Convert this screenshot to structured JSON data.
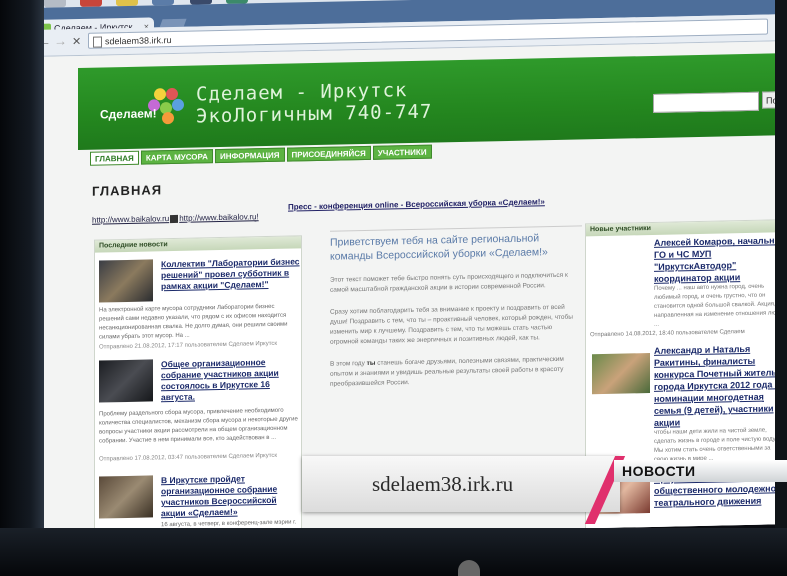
{
  "browser": {
    "tab_title": "Сделаем - Иркутск Эко...",
    "tab_close": "×",
    "url": "sdelaem38.irk.ru",
    "back": "←",
    "forward": "→",
    "stop": "✕"
  },
  "site": {
    "logo_text": "Сделаем!",
    "title_line1": "Сделаем - Иркутск",
    "title_line2": "ЭкоЛогичным 740-747",
    "search_button": "Пои",
    "menu": [
      "ГЛАВНАЯ",
      "КАРТА МУСОРА",
      "ИНФОРМАЦИЯ",
      "ПРИСОЕДИНЯЙСЯ",
      "УЧАСТНИКИ"
    ],
    "page_title": "ГЛАВНАЯ",
    "links_line": "http://www.baikalov.ru",
    "links_line2": "http://www.baikalov.ru",
    "links_line3": "!",
    "press_link": "Пресс - конференция online - Всероссийская уборка «Сделаем!»"
  },
  "left_column": {
    "heading": "Последние новости",
    "news": [
      {
        "title": "Коллектив \"Лаборатории бизнес решений\" провел субботник в рамках акции \"Сделаем!\"",
        "body": "На электронной карте мусора сотрудники Лаборатории бизнес решений сами недавно указали, что рядом с их офисом находится несанкционированная свалка. Не долго думая, они решили своими силами убрать этот мусор. На ...",
        "meta": "Отправлено 21.08.2012, 17:17 пользователем Сделаем Иркутск"
      },
      {
        "title": "Общее организационное собрание участников акции состоялось в Иркутске 16 августа.",
        "body": "Проблему раздельного сбора мусора, привлечение необходимого количества специалистов, механизм сбора мусора и некоторые другие вопросы участники акции рассмотрели на общем организационном собрании. Участие в нем принимали все, кто задействован в ...",
        "meta": "Отправлено 17.08.2012, 03:47 пользователем Сделаем Иркутск"
      },
      {
        "title": "В Иркутске пройдет организационное собрание участников Всероссийской акции «Сделаем!»",
        "body": "16 августа, в четверг, в конференц-зале мэрии г.",
        "meta": ""
      }
    ]
  },
  "center_column": {
    "title": "Приветствуем тебя на сайте региональной команды Всероссийской уборки «Сделаем!»",
    "p1": "Этот текст поможет тебе быстро понять суть происходящего и подключиться к самой масштабной гражданской акции в истории современной России.",
    "p2": "Сразу хотим поблагодарить тебя за внимание к проекту и поздравить от всей души! Поздравить с тем, что ты – проактивный человек, который рожден, чтобы изменить мир к лучшему. Поздравить с тем, что ты можешь стать частью огромной команды таких же энергичных и позитивных людей, как ты.",
    "p3_bold": "ты",
    "p3_a": "В этом году",
    "p3_b": "станешь богаче друзьями, полезными связями, практическим опытом и знаниями и увидишь реальные результаты своей работы в красоту преобразившейся России."
  },
  "right_column": {
    "heading": "Новые участники",
    "items": [
      {
        "title": "Алексей Комаров, начальник ГО и ЧС МУП \"ИркутскАвтодор\" координатор акции",
        "body": "Почему ... наш авто нужна город, очень любимый город, и очень грустно, что он становится одной большой свалкой. Акция, направленная на изменение отношения людей ...",
        "meta": "Отправлено 14.08.2012, 18:40 пользователем Сделаем"
      },
      {
        "title": "Александр и Наталья Ракитины, финалисты конкурса Почетный житель города Иркутска 2012 года в номинации многодетная семья (9 детей), участники акции",
        "body": "чтобы наши дети жили на чистой земле, сделать жизнь в городе и поле чистую воду. Мы хотим стать очень ответственными за свою жизнь в мире ...",
        "meta": ""
      },
      {
        "title": "Иркутского областного общественного молодежного театрального движения",
        "body": "",
        "meta": ""
      }
    ]
  },
  "overlay": {
    "url": "sdelaem38.irk.ru",
    "tag": "НОВОСТИ"
  },
  "colors": {
    "header_green": "#24871f",
    "menu_green": "#5cb342",
    "link_blue": "#1b2a6a",
    "accent_pink": "#e0306d"
  }
}
